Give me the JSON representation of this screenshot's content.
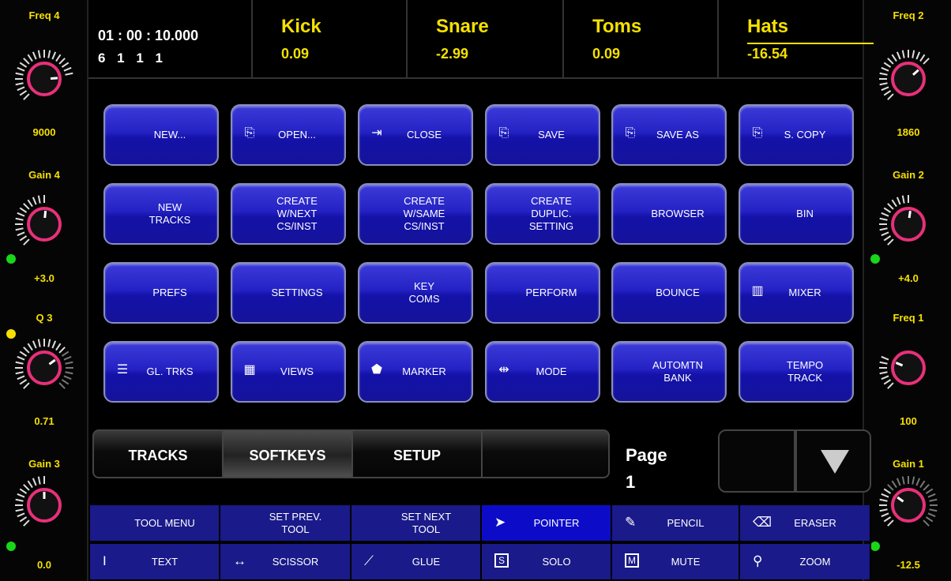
{
  "left_knobs": [
    {
      "label": "Freq 4",
      "value": "9000"
    },
    {
      "label": "Gain 4",
      "value": "+3.0"
    },
    {
      "label": "Q 3",
      "value": "0.71"
    },
    {
      "label": "Gain 3",
      "value": "0.0"
    }
  ],
  "right_knobs": [
    {
      "label": "Freq 2",
      "value": "1860"
    },
    {
      "label": "Gain 2",
      "value": "+4.0"
    },
    {
      "label": "Freq 1",
      "value": "100"
    },
    {
      "label": "Gain 1",
      "value": "-12.5"
    }
  ],
  "colors": {
    "accent": "#f5e000",
    "knob_ring": "#e8307a",
    "button_blue": "#2422c4",
    "tool_blue": "#1a1a8a",
    "tool_selected": "#0c0cc8",
    "indicator_green": "#19d619",
    "indicator_yellow": "#f5e000"
  },
  "header": {
    "time": "01 : 00 : 10.000",
    "bars": "6 1 1 1",
    "tracks": [
      {
        "name": "Kick",
        "value": "0.09"
      },
      {
        "name": "Snare",
        "value": "-2.99"
      },
      {
        "name": "Toms",
        "value": "0.09"
      },
      {
        "name": "Hats",
        "value": "-16.54"
      }
    ]
  },
  "softkeys": [
    {
      "label": "NEW...",
      "icon": ""
    },
    {
      "label": "OPEN...",
      "icon": "open-icon"
    },
    {
      "label": "CLOSE",
      "icon": "close-doc-icon"
    },
    {
      "label": "SAVE",
      "icon": "save-icon"
    },
    {
      "label": "SAVE AS",
      "icon": "save-as-icon"
    },
    {
      "label": "S. COPY",
      "icon": "save-copy-icon"
    },
    {
      "label": "NEW\nTRACKS",
      "icon": ""
    },
    {
      "label": "CREATE\nW/NEXT\nCS/INST",
      "icon": ""
    },
    {
      "label": "CREATE\nW/SAME\nCS/INST",
      "icon": ""
    },
    {
      "label": "CREATE\nDUPLIC.\nSETTING",
      "icon": ""
    },
    {
      "label": "BROWSER",
      "icon": ""
    },
    {
      "label": "BIN",
      "icon": ""
    },
    {
      "label": "PREFS",
      "icon": ""
    },
    {
      "label": "SETTINGS",
      "icon": ""
    },
    {
      "label": "KEY\nCOMS",
      "icon": ""
    },
    {
      "label": "PERFORM",
      "icon": ""
    },
    {
      "label": "BOUNCE",
      "icon": ""
    },
    {
      "label": "MIXER",
      "icon": "mixer-icon"
    },
    {
      "label": "GL. TRKS",
      "icon": "list-icon"
    },
    {
      "label": "VIEWS",
      "icon": "views-icon"
    },
    {
      "label": "MARKER",
      "icon": "marker-icon"
    },
    {
      "label": "MODE",
      "icon": "mode-icon"
    },
    {
      "label": "AUTOMTN\nBANK",
      "icon": ""
    },
    {
      "label": "TEMPO\nTRACK",
      "icon": ""
    }
  ],
  "tabs": [
    {
      "label": "TRACKS",
      "active": false
    },
    {
      "label": "SOFTKEYS",
      "active": true
    },
    {
      "label": "SETUP",
      "active": false
    },
    {
      "label": "",
      "active": false
    }
  ],
  "page": {
    "label": "Page",
    "number": "1"
  },
  "tools": [
    {
      "label": "TOOL MENU",
      "icon": ""
    },
    {
      "label": "SET PREV.\nTOOL",
      "icon": ""
    },
    {
      "label": "SET NEXT\nTOOL",
      "icon": ""
    },
    {
      "label": "POINTER",
      "icon": "pointer-icon",
      "selected": true
    },
    {
      "label": "PENCIL",
      "icon": "pencil-icon"
    },
    {
      "label": "ERASER",
      "icon": "eraser-icon"
    },
    {
      "label": "TEXT",
      "icon": "text-cursor-icon"
    },
    {
      "label": "SCISSOR",
      "icon": "scissor-icon"
    },
    {
      "label": "GLUE",
      "icon": "glue-icon"
    },
    {
      "label": "SOLO",
      "icon": "solo-icon"
    },
    {
      "label": "MUTE",
      "icon": "mute-icon"
    },
    {
      "label": "ZOOM",
      "icon": "zoom-icon"
    }
  ]
}
